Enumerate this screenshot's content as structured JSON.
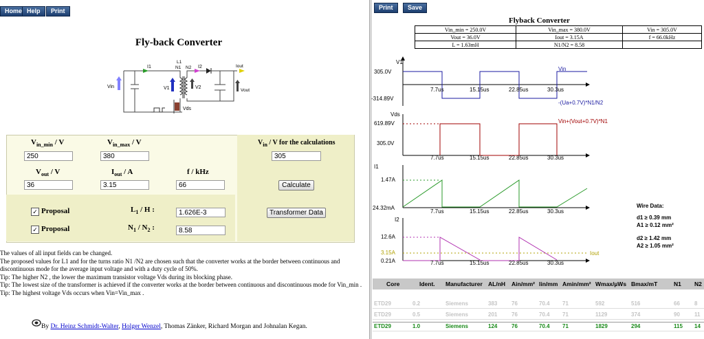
{
  "nav_left": {
    "home": "Home",
    "help": "Help",
    "print": "Print"
  },
  "nav_right": {
    "print": "Print",
    "save": "Save"
  },
  "title": "Fly-back Converter",
  "circuit": {
    "I1": "I1",
    "L1": "L1",
    "N1": "N1",
    "N2": "N2",
    "I2": "I2",
    "Iout": "Iout",
    "Vin": "Vin",
    "V1": "V1",
    "V2": "V2",
    "Vout": "Vout",
    "Vds": "Vds"
  },
  "form": {
    "vin_min_label": "V",
    "vin_min_sub": "in_min",
    "vin_min_unit": " / V",
    "vin_min": "250",
    "vin_max_label": "V",
    "vin_max_sub": "in_max",
    "vin_max_unit": " / V",
    "vin_max": "380",
    "vin_calc_label": "V",
    "vin_calc_sub": "in",
    "vin_calc_unit": " / V for the calculations",
    "vin_calc": "305",
    "vout_label": "V",
    "vout_sub": "out",
    "vout_unit": " / V",
    "vout": "36",
    "iout_label": "I",
    "iout_sub": "out",
    "iout_unit": " / A",
    "iout": "3.15",
    "f_label": "f / kHz",
    "f": "66",
    "calculate": "Calculate",
    "proposal": "Proposal",
    "l1_label": "L",
    "l1_sub": "1",
    "l1_unit": " / H :",
    "l1": "1.626E-3",
    "n_label": "N",
    "n_sub1": "1",
    "n_mid": " / N",
    "n_sub2": "2",
    "n_unit": " :",
    "n": "8.58",
    "transformer": "Transformer Data"
  },
  "notes": [
    "The values of all input fields can be changed.",
    "The proposed values for L1 and for the turns ratio N1 /N2 are chosen such that the converter works at the border between continuous and discontinuous mode for the average input voltage and with a duty cycle of 50%.",
    "Tip: The higher N2 , the lower the maximum transistor voltage Vds during its blocking phase.",
    "Tip: The lowest size of the transformer is achieved if the converter works at the border between continuous and discontinuous mode for Vin_min .",
    "Tip: The highest voltage Vds occurs when Vin=Vin_max ."
  ],
  "authors": {
    "by": "By ",
    "a1": "Dr. Heinz Schmidt-Walter",
    "sep1": ", ",
    "a2": "Holger Wenzel",
    "rest": ", Thomas Zänker, Richard Morgan and Johnalan Kegan."
  },
  "right": {
    "title": "Flyback Converter",
    "params": [
      [
        "Vin_min = 250.0V",
        "Vin_max = 380.0V",
        "Vin = 305.0V"
      ],
      [
        "Vout = 36.0V",
        "Iout = 3.15A",
        "f = 66.0kHz"
      ],
      [
        "L = 1.63mH",
        "N1/N2 = 8.58",
        ""
      ]
    ],
    "time_ticks": [
      "7.7us",
      "15.15us",
      "22.85us",
      "30.3us"
    ],
    "plot1": {
      "ylabel": "V1",
      "top": "305.0V",
      "bottom": "-314.89V",
      "series_top": "Vin",
      "series_bottom": "-(Ua+0.7V)*N1/N2"
    },
    "plot2": {
      "ylabel": "Vds",
      "top": "619.89V",
      "mid": "305.0V",
      "series": "Vin+(Vout+0.7V)*N1"
    },
    "plot3": {
      "ylabel": "I1",
      "top": "1.47A",
      "bottom": "24.32mA"
    },
    "plot4": {
      "ylabel": "I2",
      "top": "12.6A",
      "mid": "3.15A",
      "bottom": "0.21A",
      "series": "Iout"
    },
    "wire": {
      "title": "Wire Data:",
      "d1": "d1 ≥ 0.39 mm",
      "a1": "A1 ≥ 0.12 mm²",
      "d2": "d2 ≥ 1.42 mm",
      "a2": "A2 ≥ 1.05 mm²"
    },
    "core_headers": [
      "Core",
      "Ident.",
      "Manufacturer",
      "AL/nH",
      "Ain/mm²",
      "lin/mm",
      "Amin/mm²",
      "Wmax/µWs",
      "Bmax/mT",
      "N1",
      "N2"
    ],
    "core_rows": [
      {
        "cells": [
          "ETD29",
          "0.2",
          "Siemens",
          "383",
          "76",
          "70.4",
          "71",
          "592",
          "516",
          "66",
          "8"
        ],
        "state": "faded"
      },
      {
        "cells": [
          "ETD29",
          "0.5",
          "Siemens",
          "201",
          "76",
          "70.4",
          "71",
          "1129",
          "374",
          "90",
          "11"
        ],
        "state": "faded"
      },
      {
        "cells": [
          "ETD29",
          "1.0",
          "Siemens",
          "124",
          "76",
          "70.4",
          "71",
          "1829",
          "294",
          "115",
          "14"
        ],
        "state": "active"
      }
    ]
  },
  "colors": {
    "nav": "#1d3f70",
    "panel": "#efefc8",
    "wave_blue": "#1a1aa0",
    "wave_red": "#a00000",
    "wave_green": "#2a9a2a",
    "wave_magenta": "#b030b0",
    "core_green": "#1a8a1a"
  }
}
